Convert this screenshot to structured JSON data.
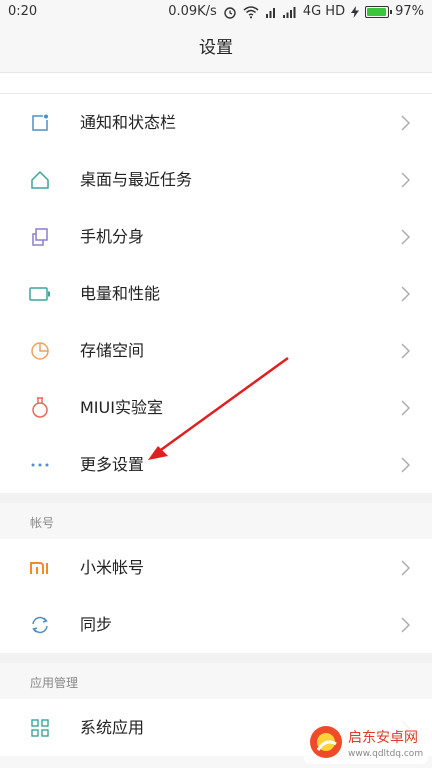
{
  "status_bar": {
    "time": "0:20",
    "speed": "0.09K/s",
    "network": "4G HD",
    "battery_text": "97%",
    "battery_level": 0.97
  },
  "header": {
    "title": "设置"
  },
  "group1": {
    "items": [
      {
        "label": "通知和状态栏",
        "icon": "notification-icon"
      },
      {
        "label": "桌面与最近任务",
        "icon": "home-icon"
      },
      {
        "label": "手机分身",
        "icon": "dual-phone-icon"
      },
      {
        "label": "电量和性能",
        "icon": "battery-icon"
      },
      {
        "label": "存储空间",
        "icon": "storage-pie-icon"
      },
      {
        "label": "MIUI实验室",
        "icon": "lab-flask-icon"
      },
      {
        "label": "更多设置",
        "icon": "more-dots-icon"
      }
    ]
  },
  "account": {
    "header": "帐号",
    "items": [
      {
        "label": "小米帐号",
        "icon": "mi-logo-icon"
      },
      {
        "label": "同步",
        "icon": "sync-icon"
      }
    ]
  },
  "apps": {
    "header": "应用管理",
    "items": [
      {
        "label": "系统应用",
        "icon": "grid-apps-icon"
      }
    ]
  },
  "watermark": {
    "brand": "启东安卓网",
    "url": "www.qdltdq.com"
  },
  "colors": {
    "icon_blue": "#4f8fc6",
    "icon_teal": "#3aa69a",
    "icon_purple": "#8c7fd0",
    "icon_orange": "#f0a05a",
    "icon_red": "#e46a5b",
    "mi_orange": "#f08a2b",
    "arrow_red": "#e02020"
  }
}
